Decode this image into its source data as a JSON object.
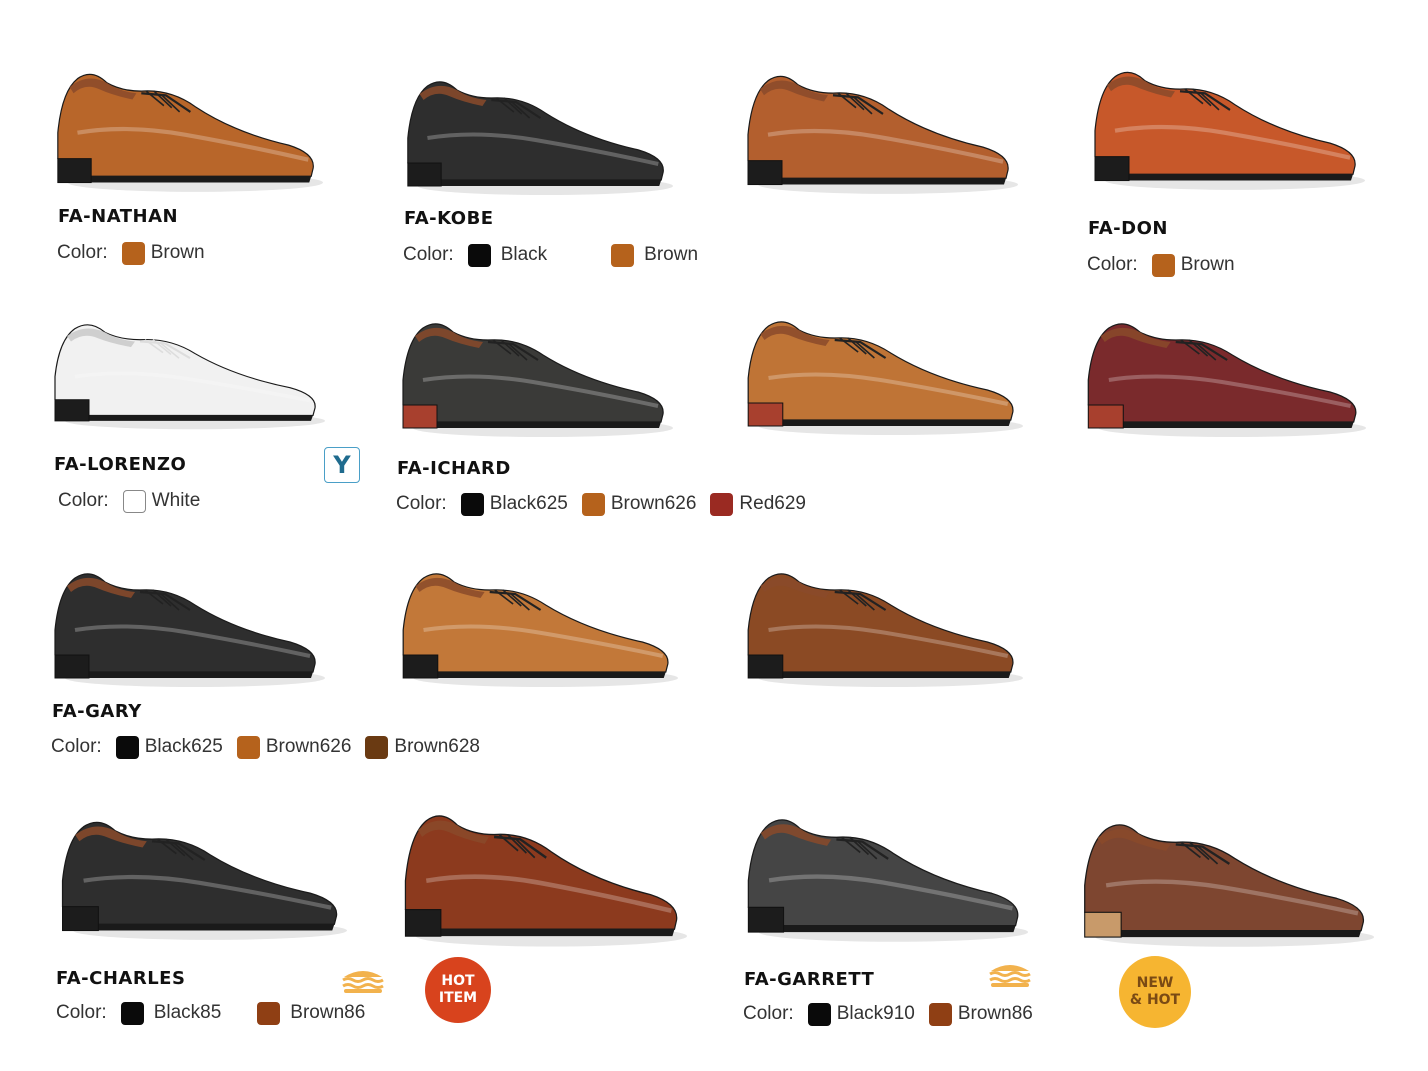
{
  "products": {
    "nathan": {
      "name": "FA-NATHAN",
      "color_label": "Color:",
      "options": [
        {
          "label": "Brown",
          "color": "#b5621c"
        }
      ]
    },
    "kobe": {
      "name": "FA-KOBE",
      "color_label": "Color:",
      "options": [
        {
          "label": "Black",
          "color": "#0a0a0a"
        },
        {
          "label": "Brown",
          "color": "#b5621c"
        }
      ]
    },
    "don": {
      "name": "FA-DON",
      "color_label": "Color:",
      "options": [
        {
          "label": "Brown",
          "color": "#b5621c"
        }
      ]
    },
    "lorenzo": {
      "name": "FA-LORENZO",
      "color_label": "Color:",
      "options": [
        {
          "label": "White",
          "color": "#ffffff"
        }
      ]
    },
    "ichard": {
      "name": "FA-ICHARD",
      "color_label": "Color:",
      "options": [
        {
          "label": "Black625",
          "color": "#0a0a0a"
        },
        {
          "label": "Brown626",
          "color": "#b5621c"
        },
        {
          "label": "Red629",
          "color": "#9a2a22"
        }
      ]
    },
    "gary": {
      "name": "FA-GARY",
      "color_label": "Color:",
      "options": [
        {
          "label": "Black625",
          "color": "#0a0a0a"
        },
        {
          "label": "Brown626",
          "color": "#b5621c"
        },
        {
          "label": "Brown628",
          "color": "#6a3a12"
        }
      ]
    },
    "charles": {
      "name": "FA-CHARLES",
      "color_label": "Color:",
      "options": [
        {
          "label": "Black85",
          "color": "#0a0a0a"
        },
        {
          "label": "Brown86",
          "color": "#8f3f14"
        }
      ]
    },
    "garrett": {
      "name": "FA-GARRETT",
      "color_label": "Color:",
      "options": [
        {
          "label": "Black910",
          "color": "#0a0a0a"
        },
        {
          "label": "Brown86",
          "color": "#8f3f14"
        }
      ]
    }
  },
  "badges": {
    "y_badge": "Y",
    "hot_line1": "HOT",
    "hot_line2": "ITEM",
    "new_line1": "NEW",
    "new_line2": "& HOT"
  },
  "shoe_colors": {
    "tan": "#b8662a",
    "black": "#2e2e2e",
    "cognac": "#b35f2e",
    "orange": "#c7582a",
    "white": "#f1f1f1",
    "grey_black": "#3a3a38",
    "camel": "#bf7436",
    "burgundy": "#7a2a2c",
    "caramel": "#c27839",
    "mid_brown": "#8b4a24",
    "reddish_brown": "#8c3a1e",
    "charcoal_textured": "#454545",
    "chestnut": "#7e4630"
  }
}
